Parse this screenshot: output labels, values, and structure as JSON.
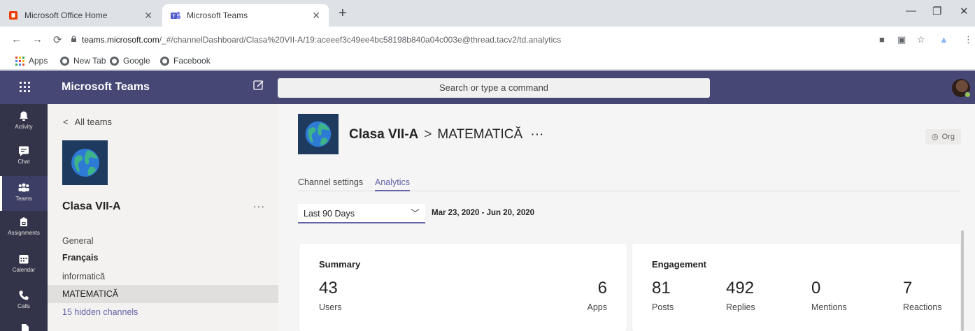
{
  "browser": {
    "tabs": [
      {
        "title": "Microsoft Office Home",
        "icon": "office-icon",
        "active": false
      },
      {
        "title": "Microsoft Teams",
        "icon": "teams-icon",
        "active": true
      }
    ],
    "url_host": "teams.microsoft.com",
    "url_path": "/_#/channelDashboard/Clasa%20VII-A/19:aceeef3c49ee4bc58198b840a04c003e@thread.tacv2/td.analytics",
    "bookmarks": [
      {
        "label": "Apps",
        "icon": "apps-grid-icon"
      },
      {
        "label": "New Tab",
        "icon": "globe-icon"
      },
      {
        "label": "Google",
        "icon": "globe-icon"
      },
      {
        "label": "Facebook",
        "icon": "globe-icon"
      }
    ]
  },
  "teams": {
    "app_name": "Microsoft Teams",
    "search_placeholder": "Search or type a command",
    "header_color": "#464775",
    "rail_color": "#33344a",
    "accent": "#6264a7",
    "rail": [
      {
        "label": "Activity",
        "icon": "bell-icon",
        "active": false
      },
      {
        "label": "Chat",
        "icon": "chat-icon",
        "active": false
      },
      {
        "label": "Teams",
        "icon": "teams-icon",
        "active": true
      },
      {
        "label": "Assignments",
        "icon": "assignments-icon",
        "active": false
      },
      {
        "label": "Calendar",
        "icon": "calendar-icon",
        "active": false
      },
      {
        "label": "Calls",
        "icon": "phone-icon",
        "active": false
      }
    ]
  },
  "left_panel": {
    "back_label": "All teams",
    "team_name": "Clasa VII-A",
    "more": "···",
    "channels": [
      {
        "label": "General",
        "bold": false,
        "selected": false
      },
      {
        "label": "Français",
        "bold": true,
        "selected": false
      },
      {
        "label": "informatică",
        "bold": false,
        "selected": false
      },
      {
        "label": "MATEMATICĂ",
        "bold": false,
        "selected": true
      }
    ],
    "hidden_channels": "15 hidden channels"
  },
  "main": {
    "team": "Clasa VII-A",
    "separator": ">",
    "channel": "MATEMATICĂ",
    "more": "···",
    "org_badge": "Org",
    "tabs": [
      {
        "label": "Channel settings",
        "active": false
      },
      {
        "label": "Analytics",
        "active": true
      }
    ],
    "period": "Last 90 Days",
    "date_range": "Mar 23, 2020 - Jun 20, 2020",
    "summary": {
      "title": "Summary",
      "users_value": "43",
      "users_label": "Users",
      "apps_value": "6",
      "apps_label": "Apps"
    },
    "engagement": {
      "title": "Engagement",
      "metrics": [
        {
          "value": "81",
          "label": "Posts"
        },
        {
          "value": "492",
          "label": "Replies"
        },
        {
          "value": "0",
          "label": "Mentions"
        },
        {
          "value": "7",
          "label": "Reactions"
        }
      ]
    }
  }
}
